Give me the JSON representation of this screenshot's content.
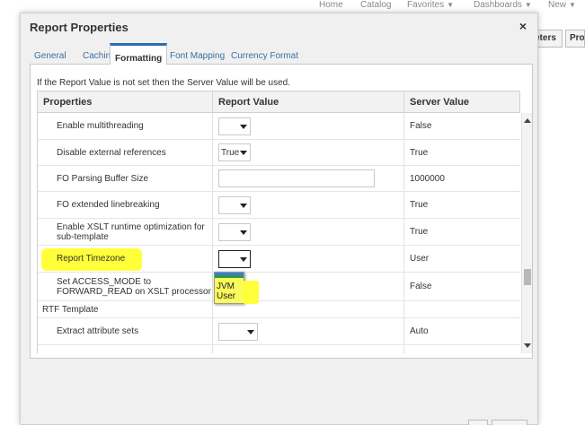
{
  "topnav": {
    "home": "Home",
    "catalog": "Catalog",
    "favorites": "Favorites",
    "dashboards": "Dashboards",
    "new": "New"
  },
  "background_buttons": {
    "parameters_partial": "eters",
    "properties_partial": "Prop"
  },
  "dialog": {
    "title": "Report Properties",
    "close_label": "×",
    "tabs": [
      "General",
      "Caching",
      "Formatting",
      "Font Mapping",
      "Currency Format"
    ],
    "active_tab": "Formatting",
    "info": "If the Report Value is not set then the Server Value will be used.",
    "columns": {
      "properties": "Properties",
      "report_value": "Report Value",
      "server_value": "Server Value"
    },
    "rows": [
      {
        "label": "Enable multithreading",
        "report_value": "",
        "control": "select",
        "server_value": "False"
      },
      {
        "label": "Disable external references",
        "report_value": "True",
        "control": "select",
        "server_value": "True"
      },
      {
        "label": "FO Parsing Buffer Size",
        "report_value": "",
        "control": "text",
        "server_value": "1000000"
      },
      {
        "label": "FO extended linebreaking",
        "report_value": "",
        "control": "select",
        "server_value": "True"
      },
      {
        "label": "Enable XSLT runtime optimization for sub-template",
        "report_value": "",
        "control": "select",
        "server_value": "True"
      },
      {
        "label": "Report Timezone",
        "report_value": "",
        "control": "select",
        "server_value": "User",
        "highlighted": true
      },
      {
        "label": "Set ACCESS_MODE to FORWARD_READ on XSLT processor",
        "report_value": "",
        "control": "select",
        "server_value": "False"
      },
      {
        "label": "RTF Template",
        "section": true
      },
      {
        "label": "Extract attribute sets",
        "report_value": "",
        "control": "select",
        "server_value": "Auto"
      }
    ],
    "timezone_dropdown_options": [
      "JVM",
      "User"
    ]
  },
  "colors": {
    "highlight": "#ffff3a",
    "active_tab_border": "#2b6cb0",
    "tab_text": "#3a6ea5"
  }
}
